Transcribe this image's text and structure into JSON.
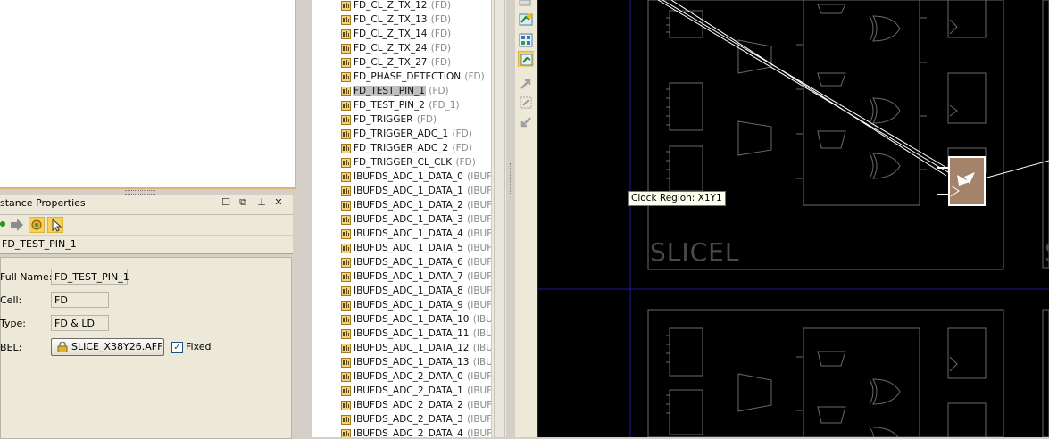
{
  "instance_properties": {
    "title": "stance Properties",
    "instance_name": "FD_TEST_PIN_1",
    "fields": {
      "full_name_label": "Full Name:",
      "full_name": "FD_TEST_PIN_1",
      "cell_label": "Cell:",
      "cell": "FD",
      "type_label": "Type:",
      "type": "FD & LD",
      "bel_label": "BEL:",
      "bel": "SLICE_X38Y26.AFF",
      "fixed_label": "Fixed",
      "fixed": true
    }
  },
  "tree": {
    "items": [
      {
        "name": "FD_CL_Z_TX_12",
        "type": "(FD)",
        "selected": false
      },
      {
        "name": "FD_CL_Z_TX_13",
        "type": "(FD)",
        "selected": false
      },
      {
        "name": "FD_CL_Z_TX_14",
        "type": "(FD)",
        "selected": false
      },
      {
        "name": "FD_CL_Z_TX_24",
        "type": "(FD)",
        "selected": false
      },
      {
        "name": "FD_CL_Z_TX_27",
        "type": "(FD)",
        "selected": false
      },
      {
        "name": "FD_PHASE_DETECTION",
        "type": "(FD)",
        "selected": false
      },
      {
        "name": "FD_TEST_PIN_1",
        "type": "(FD)",
        "selected": true
      },
      {
        "name": "FD_TEST_PIN_2",
        "type": "(FD_1)",
        "selected": false
      },
      {
        "name": "FD_TRIGGER",
        "type": "(FD)",
        "selected": false
      },
      {
        "name": "FD_TRIGGER_ADC_1",
        "type": "(FD)",
        "selected": false
      },
      {
        "name": "FD_TRIGGER_ADC_2",
        "type": "(FD)",
        "selected": false
      },
      {
        "name": "FD_TRIGGER_CL_CLK",
        "type": "(FD)",
        "selected": false
      },
      {
        "name": "IBUFDS_ADC_1_DATA_0",
        "type": "(IBUFI",
        "selected": false
      },
      {
        "name": "IBUFDS_ADC_1_DATA_1",
        "type": "(IBUFI",
        "selected": false
      },
      {
        "name": "IBUFDS_ADC_1_DATA_2",
        "type": "(IBUFI",
        "selected": false
      },
      {
        "name": "IBUFDS_ADC_1_DATA_3",
        "type": "(IBUFI",
        "selected": false
      },
      {
        "name": "IBUFDS_ADC_1_DATA_4",
        "type": "(IBUFI",
        "selected": false
      },
      {
        "name": "IBUFDS_ADC_1_DATA_5",
        "type": "(IBUFI",
        "selected": false
      },
      {
        "name": "IBUFDS_ADC_1_DATA_6",
        "type": "(IBUFI",
        "selected": false
      },
      {
        "name": "IBUFDS_ADC_1_DATA_7",
        "type": "(IBUFI",
        "selected": false
      },
      {
        "name": "IBUFDS_ADC_1_DATA_8",
        "type": "(IBUFI",
        "selected": false
      },
      {
        "name": "IBUFDS_ADC_1_DATA_9",
        "type": "(IBUFI",
        "selected": false
      },
      {
        "name": "IBUFDS_ADC_1_DATA_10",
        "type": "(IBUF",
        "selected": false
      },
      {
        "name": "IBUFDS_ADC_1_DATA_11",
        "type": "(IBUF",
        "selected": false
      },
      {
        "name": "IBUFDS_ADC_1_DATA_12",
        "type": "(IBUF",
        "selected": false
      },
      {
        "name": "IBUFDS_ADC_1_DATA_13",
        "type": "(IBUF",
        "selected": false
      },
      {
        "name": "IBUFDS_ADC_2_DATA_0",
        "type": "(IBUFI",
        "selected": false
      },
      {
        "name": "IBUFDS_ADC_2_DATA_1",
        "type": "(IBUFI",
        "selected": false
      },
      {
        "name": "IBUFDS_ADC_2_DATA_2",
        "type": "(IBUFI",
        "selected": false
      },
      {
        "name": "IBUFDS_ADC_2_DATA_3",
        "type": "(IBUFI",
        "selected": false
      },
      {
        "name": "IBUFDS_ADC_2_DATA_4",
        "type": "(IBUFI",
        "selected": false
      }
    ]
  },
  "device_view": {
    "tooltip": "Clock Region: X1Y1",
    "slice_label": "SLICEL",
    "selected_color": "#a5826a",
    "region_line_color": "#1a1aa0"
  }
}
